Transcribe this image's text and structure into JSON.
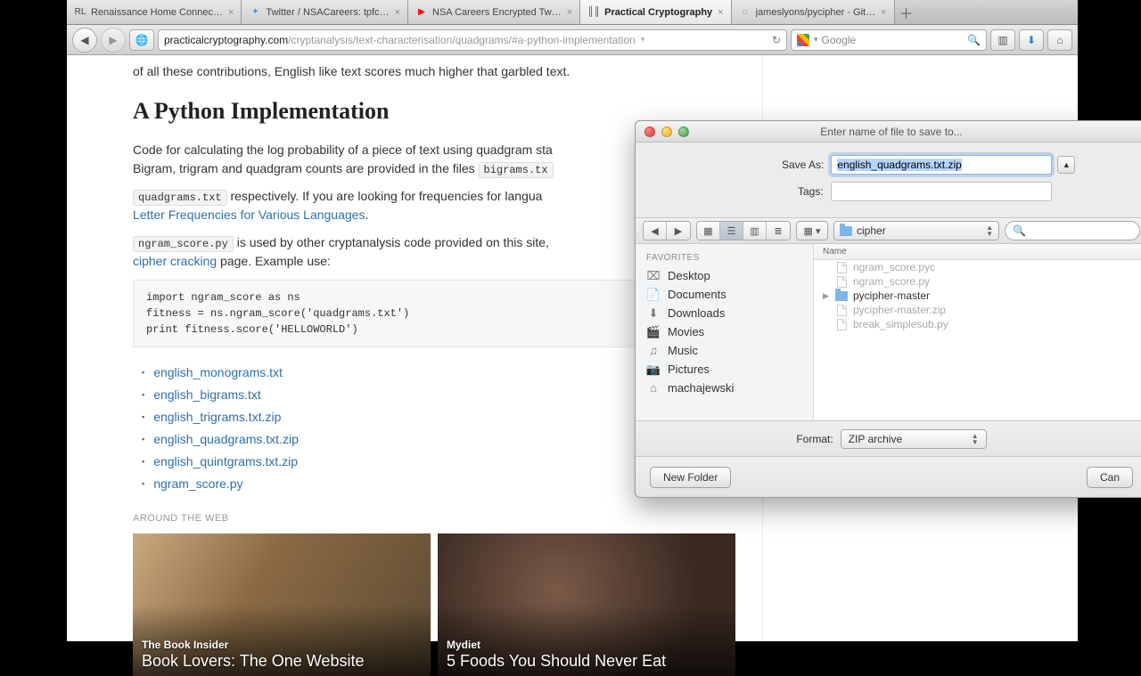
{
  "tabs": [
    {
      "label": "Renaissance Home Connec…",
      "fav": "RL"
    },
    {
      "label": "Twitter / NSACareers: tpfc…",
      "fav": "tw"
    },
    {
      "label": "NSA Careers Encrypted Tw…",
      "fav": "yt"
    },
    {
      "label": "Practical Cryptography",
      "fav": "pc",
      "active": true
    },
    {
      "label": "jameslyons/pycipher · Git…",
      "fav": "gh"
    }
  ],
  "url": {
    "host": "practicalcryptography.com",
    "path": "/cryptanalysis/text-characterisation/quadgrams/#a-python-implementation"
  },
  "search": {
    "placeholder": "Google"
  },
  "article": {
    "tail": "of all these contributions, English like text scores much higher that garbled text.",
    "heading": "A Python Implementation",
    "p1a": "Code for calculating the log probability of a piece of text using quadgram sta",
    "p1b": "Bigram, trigram and quadgram counts are provided in the files ",
    "code_bigrams": "bigrams.tx",
    "code_quadgrams": "quadgrams.txt",
    "p2a": " respectively. If you are looking for frequencies for langua",
    "link_letter": "Letter Frequencies for Various Languages",
    "code_ngram": "ngram_score.py",
    "p3a": " is used by other cryptanalysis code provided on this site, ",
    "link_cipher": "cipher cracking",
    "p3b": " page. Example use:",
    "codeblock": "import ngram_score as ns\nfitness = ns.ngram_score('quadgrams.txt')\nprint fitness.score('HELLOWORLD')",
    "downloads": [
      "english_monograms.txt",
      "english_bigrams.txt",
      "english_trigrams.txt.zip",
      "english_quadgrams.txt.zip",
      "english_quintgrams.txt.zip",
      "ngram_score.py"
    ],
    "around": "AROUND THE WEB",
    "cards": [
      {
        "src": "The Book Insider",
        "title": "Book Lovers: The One Website"
      },
      {
        "src": "Mydiet",
        "title": "5 Foods You Should Never Eat"
      }
    ]
  },
  "dialog": {
    "title": "Enter name of file to save to...",
    "saveas_label": "Save As:",
    "saveas_value": "english_quadgrams.txt.zip",
    "tags_label": "Tags:",
    "folder": "cipher",
    "fav_header": "FAVORITES",
    "favorites": [
      "Desktop",
      "Documents",
      "Downloads",
      "Movies",
      "Music",
      "Pictures",
      "machajewski"
    ],
    "fav_icons": [
      "⌧",
      "📄",
      "⬇",
      "🎬",
      "♫",
      "📷",
      "⌂"
    ],
    "name_header": "Name",
    "files": [
      {
        "name": "ngram_score.pyc",
        "type": "doc"
      },
      {
        "name": "ngram_score.py",
        "type": "doc"
      },
      {
        "name": "pycipher-master",
        "type": "folder",
        "disclosure": true
      },
      {
        "name": "pycipher-master.zip",
        "type": "doc"
      },
      {
        "name": "break_simplesub.py",
        "type": "doc"
      }
    ],
    "format_label": "Format:",
    "format_value": "ZIP archive",
    "new_folder": "New Folder",
    "cancel": "Can"
  }
}
